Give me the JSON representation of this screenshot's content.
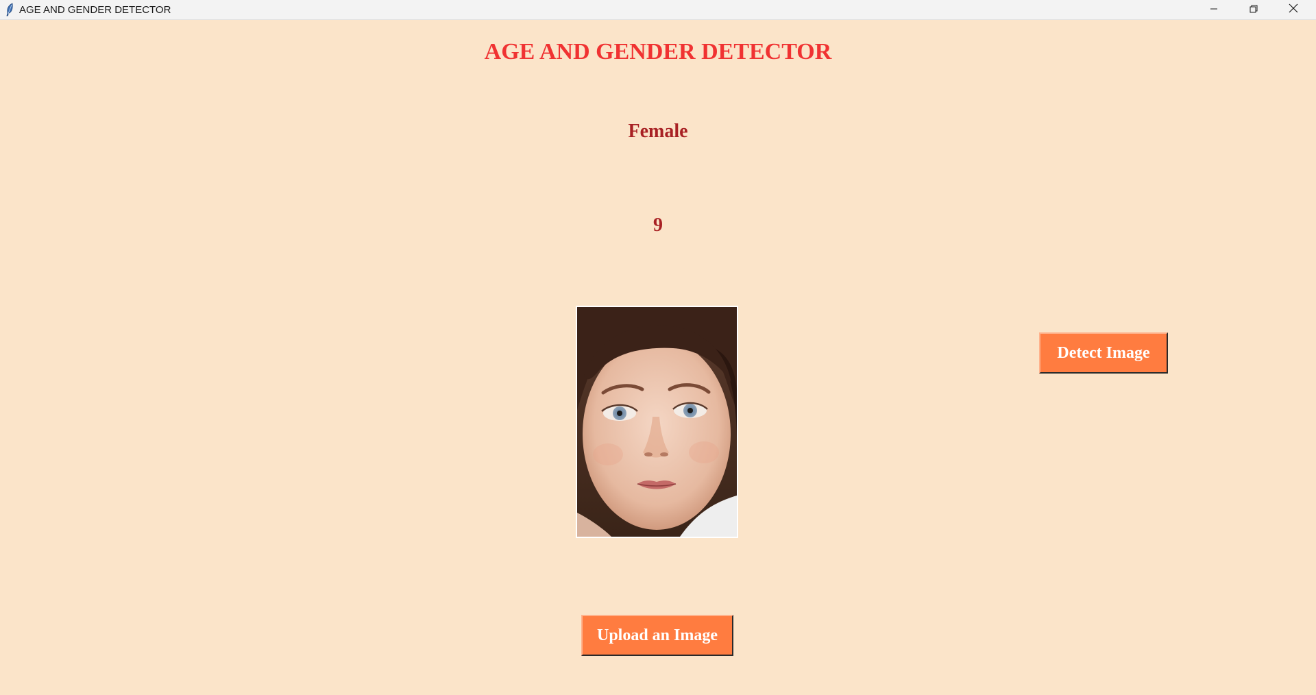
{
  "window": {
    "title": "AGE AND GENDER DETECTOR",
    "app_icon": "feather-icon",
    "controls": {
      "minimize_icon": "minimize-icon",
      "maximize_icon": "restore-icon",
      "close_icon": "close-icon"
    }
  },
  "main": {
    "heading": "AGE AND GENDER DETECTOR",
    "gender_result": "Female",
    "age_result": "9",
    "image_description": "uploaded-face-photo"
  },
  "buttons": {
    "detect_label": "Detect Image",
    "upload_label": "Upload an Image"
  },
  "colors": {
    "background": "#fbe4c9",
    "heading": "#f03232",
    "result_text": "#a82124",
    "button": "#ff7c40",
    "button_text": "#ffffff"
  }
}
